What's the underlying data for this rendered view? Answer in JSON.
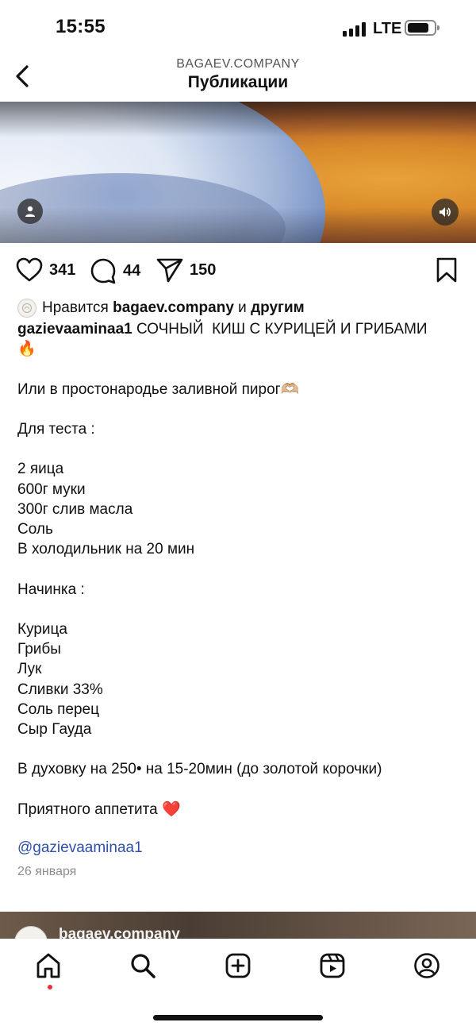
{
  "status_bar": {
    "time": "15:55",
    "network": "LTE"
  },
  "header": {
    "account": "BAGAEV.COMPANY",
    "title": "Публикации"
  },
  "media": {
    "user_tag_icon": "person-icon",
    "sound_icon": "speaker-icon"
  },
  "actions": {
    "likes": "341",
    "comments": "44",
    "shares": "150"
  },
  "likes_line": {
    "prefix": "Нравится ",
    "user": "bagaev.company",
    "middle": " и ",
    "others": "другим"
  },
  "caption": {
    "username": "gazievaaminaa1",
    "text": " СОЧНЫЙ  КИШ С КУРИЦЕЙ И ГРИБАМИ\n🔥\n\nИли в простонародье заливной пирог🫶🏼\n\nДля теста :\n\n2 яица\n600г муки\n300г слив масла\nСоль\nВ холодильник на 20 мин\n\nНачинка :\n\nКурица\nГрибы\nЛук\nСливки 33%\nСоль перец\nСыр Гауда\n\nВ духовку на 250• на 15-20мин (до золотой корочки)\n\nПриятного аппетита ❤️"
  },
  "mention": "@gazievaaminaa1",
  "date": "26 января",
  "next_post": {
    "username": "bagaev.company"
  },
  "tabbar": {
    "active": "home",
    "accent": "#ed2e3f"
  },
  "colors": {
    "link": "#2f4fa8",
    "muted": "#8e8e8e"
  }
}
